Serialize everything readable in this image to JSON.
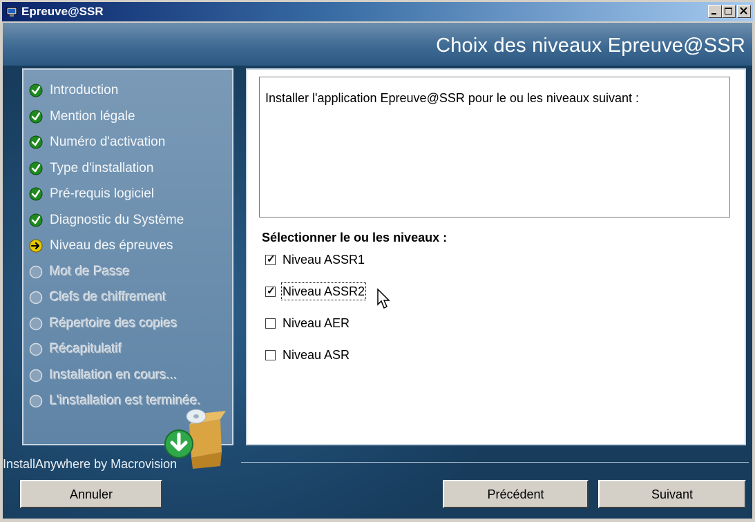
{
  "window": {
    "title": "Epreuve@SSR",
    "controls": [
      "minimize",
      "maximize",
      "close"
    ]
  },
  "header": {
    "title": "Choix des niveaux Epreuve@SSR"
  },
  "steps": [
    {
      "label": "Introduction",
      "status": "done"
    },
    {
      "label": "Mention légale",
      "status": "done"
    },
    {
      "label": "Numéro d'activation",
      "status": "done"
    },
    {
      "label": "Type d'installation",
      "status": "done"
    },
    {
      "label": "Pré-requis logiciel",
      "status": "done"
    },
    {
      "label": "Diagnostic du Système",
      "status": "done"
    },
    {
      "label": "Niveau des épreuves",
      "status": "current"
    },
    {
      "label": "Mot de Passe",
      "status": "pending"
    },
    {
      "label": "Clefs de chiffrement",
      "status": "pending"
    },
    {
      "label": "Répertoire des copies",
      "status": "pending"
    },
    {
      "label": "Récapitulatif",
      "status": "pending"
    },
    {
      "label": "Installation en cours...",
      "status": "pending"
    },
    {
      "label": "L'installation est terminée.",
      "status": "pending"
    }
  ],
  "main": {
    "description": "Installer l'application Epreuve@SSR pour le ou les niveaux suivant :",
    "select_label": "Sélectionner le ou les niveaux :",
    "options": [
      {
        "label": "Niveau ASSR1",
        "checked": true
      },
      {
        "label": "Niveau ASSR2",
        "checked": true,
        "focused": true
      },
      {
        "label": "Niveau AER",
        "checked": false
      },
      {
        "label": "Niveau ASR",
        "checked": false
      }
    ]
  },
  "footer": {
    "brand": "InstallAnywhere by Macrovision",
    "cancel_label": "Annuler",
    "previous_label": "Précédent",
    "next_label": "Suivant"
  },
  "colors": {
    "done": "#1f8a1f",
    "current": "#e8c800",
    "titlebar_start": "#0a246a",
    "titlebar_end": "#a6caf0"
  }
}
